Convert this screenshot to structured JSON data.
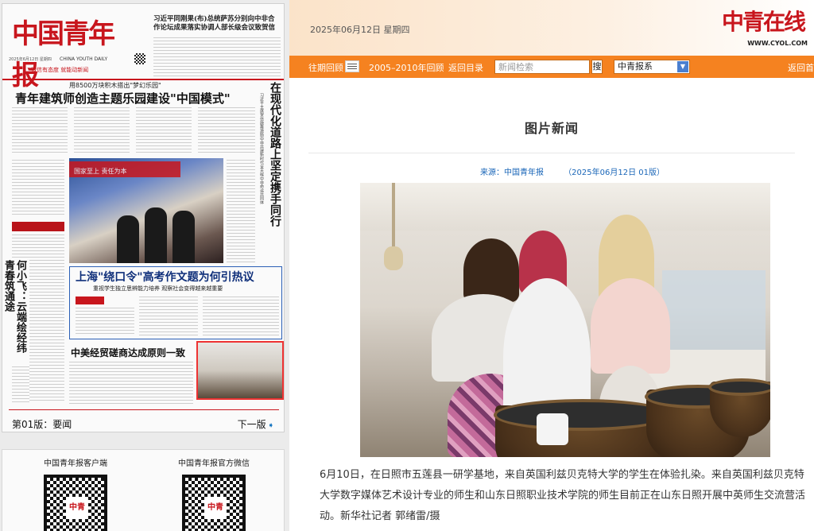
{
  "newspaper_page": {
    "masthead": "中国青年报",
    "masthead_en": "CHINA YOUTH DAILY",
    "masthead_sub": "微信有态度 就能动新闻",
    "edition_date": "2025年6月12日 星期四",
    "top_headline": "习近平同刚果(布)总统萨苏分别向中非合作论坛成果落实协调人部长级会议致贺信",
    "kicker": "用8500万块积木搭出\"梦幻乐园\"",
    "headline_1": "青年建筑师创造主题乐园建设\"中国模式\"",
    "vertical_headline": "在现代化道路上坚定携手同行",
    "vertical_sub": "习近平主席贺信鼓舞激励中非共建新时代全天候中非命运共同体",
    "left_vertical": "何小飞：云端绘经纬 青春筑通途",
    "photo_banner": "国家至上 责任为本",
    "headline_2": "上海\"绕口令\"高考作文题为何引热议",
    "headline_2_sub": "重视学生独立思辨能力培养 观察社会变得越来越重要",
    "headline_3": "中美经贸磋商达成原则一致",
    "footer_prev": "第01版：要闻",
    "footer_next": "下一版"
  },
  "apps": {
    "client_title": "中国青年报客户端",
    "wechat_title": "中国青年报官方微信",
    "qr_logo": "中青"
  },
  "header": {
    "date": "2025年06月12日 星期四",
    "logo_cn": "中青在线",
    "logo_en": "WWW.CYOL.COM"
  },
  "nav": {
    "past": "往期回顾",
    "archive": "2005–2010年回顾",
    "back_dir": "返回目录",
    "search_placeholder": "新闻检索",
    "search_btn": "搜",
    "select_value": "中青报系",
    "back_right": "返回首"
  },
  "article": {
    "section_title": "图片新闻",
    "source": "来源：中国青年报",
    "date_edition": "（2025年06月12日 01版）",
    "caption": "6月10日，在日照市五莲县一研学基地，来自英国利兹贝克特大学的学生在体验扎染。来自英国利兹贝克特大学数字媒体艺术设计专业的师生和山东日照职业技术学院的师生目前正在山东日照开展中英师生交流营活动。新华社记者 郭绪雷/摄"
  },
  "colors": {
    "brand_red": "#c8161d",
    "nav_orange": "#f58220",
    "link_blue": "#1a66b8"
  }
}
